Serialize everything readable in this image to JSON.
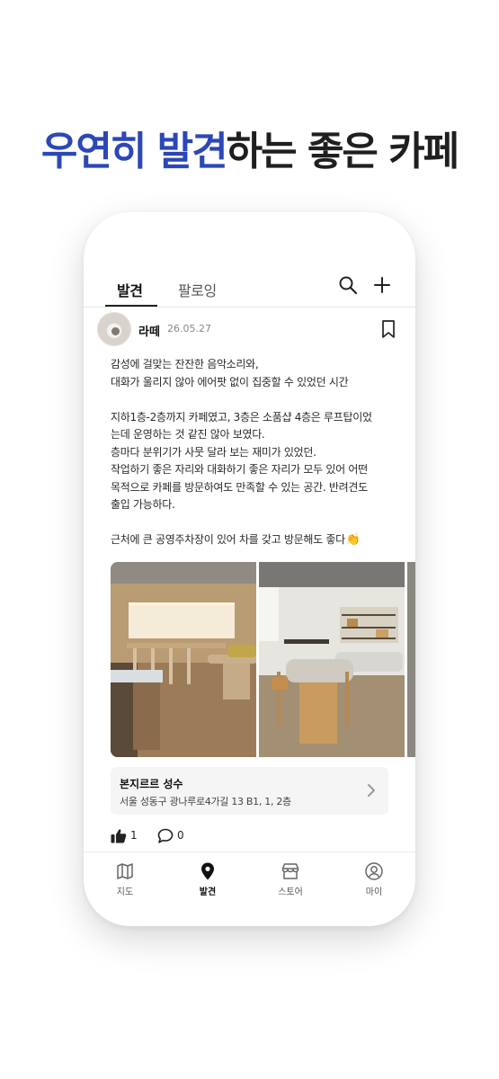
{
  "headline": {
    "accent": "우연히 발견",
    "rest": "하는 좋은 카페"
  },
  "top_tabs": [
    {
      "label": "발견",
      "active": true
    },
    {
      "label": "팔로잉",
      "active": false
    }
  ],
  "header_icons": [
    "search-icon",
    "plus-icon"
  ],
  "post": {
    "username": "라떼",
    "date": "26.05.27",
    "lines": [
      "감성에 걸맞는 잔잔한 음악소리와,",
      "대화가 울리지 않아 에어팟 없이 집중할 수 있었던 시간",
      "",
      "지하1층-2층까지 카페였고, 3층은 소품샵 4층은 루프탑이었",
      "는데 운영하는 것 같진 않아 보였다.",
      "층마다 분위기가 사뭇 달라 보는 재미가 있었던.",
      "작업하기 좋은 자리와 대화하기 좋은 자리가 모두 있어 어떤",
      "목적으로 카페를 방문하여도 만족할 수 있는 공간. 반려견도",
      "출입 가능하다.",
      "",
      "근처에 큰 공영주차장이 있어 차를 갖고 방문해도 좋다"
    ],
    "emoji": "👏",
    "place": {
      "name": "본지르르 성수",
      "address": "서울 성동구 광나루로4가길 13 B1, 1, 2층"
    },
    "likes": "1",
    "comments": "0"
  },
  "bottom_nav": [
    {
      "label": "지도",
      "icon": "map-icon",
      "active": false
    },
    {
      "label": "발견",
      "icon": "location-pin-icon",
      "active": true
    },
    {
      "label": "스토어",
      "icon": "store-icon",
      "active": false
    },
    {
      "label": "마이",
      "icon": "user-icon",
      "active": false
    }
  ],
  "colors": {
    "accent": "#2b47b8",
    "text": "#1f1f1f"
  }
}
